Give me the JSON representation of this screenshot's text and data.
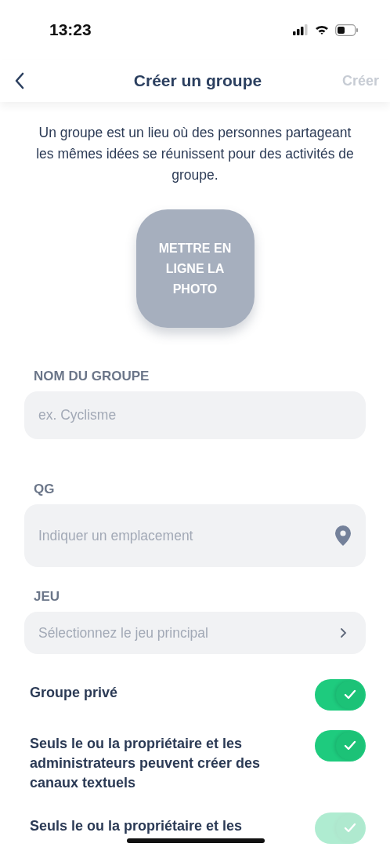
{
  "status_bar": {
    "time": "13:23"
  },
  "nav": {
    "title": "Créer un groupe",
    "action": {
      "label": "Créer",
      "disabled": true
    }
  },
  "intro": "Un groupe est un lieu où des personnes partageant les mêmes idées se réunissent pour des activités de groupe.",
  "photo_button": "METTRE EN LIGNE LA PHOTO",
  "fields": [
    {
      "kind": "text",
      "label": "NOM DU GROUPE",
      "placeholder": "ex. Cyclisme"
    },
    {
      "kind": "location",
      "label": "QG",
      "placeholder": "Indiquer un emplacement"
    },
    {
      "kind": "select",
      "label": "JEU",
      "placeholder": "Sélectionnez le jeu principal"
    }
  ],
  "toggles": [
    {
      "label": "Groupe privé",
      "on": true,
      "disabled": false
    },
    {
      "label": "Seuls le ou la propriétaire et les administrateurs peuvent créer des canaux textuels",
      "on": true,
      "disabled": false
    },
    {
      "label": "Seuls le ou la propriétaire et les",
      "on": true,
      "disabled": true
    }
  ]
}
